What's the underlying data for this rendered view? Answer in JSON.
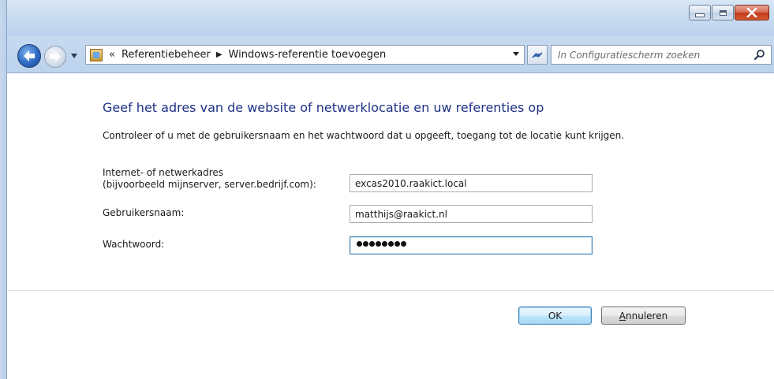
{
  "window": {
    "caption_buttons": [
      "minimize-icon",
      "maximize-icon",
      "close-icon"
    ]
  },
  "navigation": {
    "back_icon": "back-arrow-icon",
    "forward_icon": "forward-arrow-icon",
    "history_dropdown_icon": "chevron-down-icon"
  },
  "address_bar": {
    "overflow": "«",
    "breadcrumbs": [
      "Referentiebeheer",
      "Windows-referentie toevoegen"
    ],
    "separator": "▶"
  },
  "search": {
    "placeholder": "In Configuratiescherm zoeken"
  },
  "form": {
    "heading": "Geef het adres van de website of netwerklocatie en uw referenties op",
    "description": "Controleer of u met de gebruikersnaam en het wachtwoord dat u opgeeft, toegang tot de locatie kunt krijgen.",
    "address_label_line1": "Internet- of netwerkadres",
    "address_label_line2": "(bijvoorbeeld mijnserver, server.bedrijf.com):",
    "address_value": "excas2010.raakict.local",
    "username_label": "Gebruikersnaam:",
    "username_value": "matthijs@raakict.nl",
    "password_label": "Wachtwoord:",
    "password_length": 8
  },
  "buttons": {
    "ok": "OK",
    "cancel_mnemonic": "A",
    "cancel_rest": "nnuleren"
  },
  "colors": {
    "heading": "#1e3287",
    "accent": "#3c7fb1",
    "close_button": "#c23a1e"
  }
}
